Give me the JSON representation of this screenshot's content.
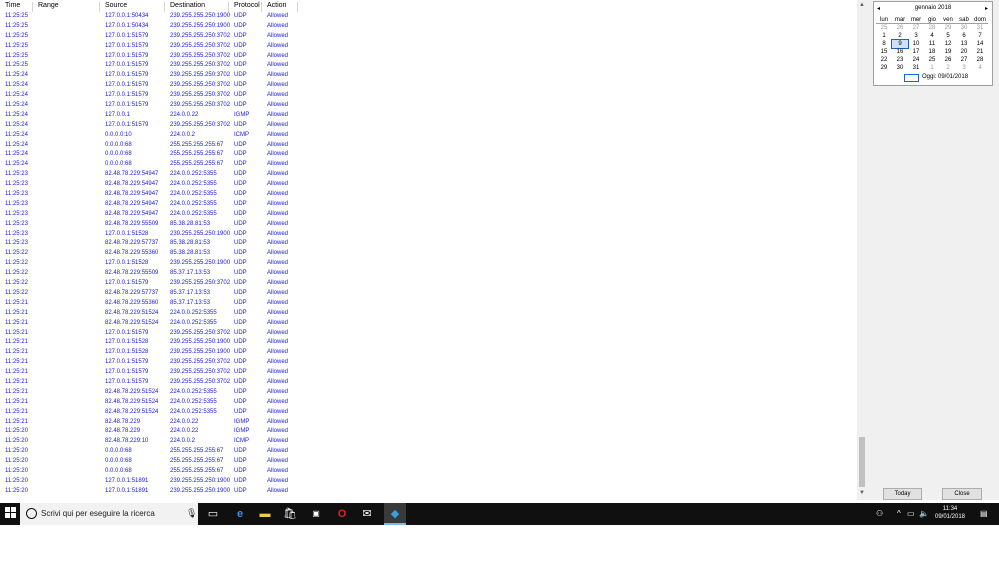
{
  "log": {
    "headers": {
      "time": "Time",
      "range": "Range",
      "source": "Source",
      "destination": "Destination",
      "protocol": "Protocol",
      "action": "Action"
    },
    "rows": [
      [
        "11:25:25",
        "127.0.0.1:50434",
        "239.255.255.250:1900",
        "UDP",
        "Allowed"
      ],
      [
        "11:25:25",
        "127.0.0.1:50434",
        "239.255.255.250:1900",
        "UDP",
        "Allowed"
      ],
      [
        "11:25:25",
        "127.0.0.1:51579",
        "239.255.255.250:3702",
        "UDP",
        "Allowed"
      ],
      [
        "11:25:25",
        "127.0.0.1:51579",
        "239.255.255.250:3702",
        "UDP",
        "Allowed"
      ],
      [
        "11:25:25",
        "127.0.0.1:51579",
        "239.255.255.250:3702",
        "UDP",
        "Allowed"
      ],
      [
        "11:25:25",
        "127.0.0.1:51579",
        "239.255.255.250:3702",
        "UDP",
        "Allowed"
      ],
      [
        "11:25:24",
        "127.0.0.1:51579",
        "239.255.255.250:3702",
        "UDP",
        "Allowed"
      ],
      [
        "11:25:24",
        "127.0.0.1:51579",
        "239.255.255.250:3702",
        "UDP",
        "Allowed"
      ],
      [
        "11:25:24",
        "127.0.0.1:51579",
        "239.255.255.250:3702",
        "UDP",
        "Allowed"
      ],
      [
        "11:25:24",
        "127.0.0.1:51579",
        "239.255.255.250:3702",
        "UDP",
        "Allowed"
      ],
      [
        "11:25:24",
        "127.0.0.1",
        "224.0.0.22",
        "IGMP",
        "Allowed"
      ],
      [
        "11:25:24",
        "127.0.0.1:51579",
        "239.255.255.250:3702",
        "UDP",
        "Allowed"
      ],
      [
        "11:25:24",
        "0.0.0.0:10",
        "224.0.0.2",
        "ICMP",
        "Allowed"
      ],
      [
        "11:25:24",
        "0.0.0.0:68",
        "255.255.255.255:67",
        "UDP",
        "Allowed"
      ],
      [
        "11:25:24",
        "0.0.0.0:68",
        "255.255.255.255:67",
        "UDP",
        "Allowed"
      ],
      [
        "11:25:24",
        "0.0.0.0:68",
        "255.255.255.255:67",
        "UDP",
        "Allowed"
      ],
      [
        "11:25:23",
        "82.48.78.229:54947",
        "224.0.0.252:5355",
        "UDP",
        "Allowed"
      ],
      [
        "11:25:23",
        "82.48.78.229:54947",
        "224.0.0.252:5355",
        "UDP",
        "Allowed"
      ],
      [
        "11:25:23",
        "82.48.78.229:54947",
        "224.0.0.252:5355",
        "UDP",
        "Allowed"
      ],
      [
        "11:25:23",
        "82.48.78.229:54947",
        "224.0.0.252:5355",
        "UDP",
        "Allowed"
      ],
      [
        "11:25:23",
        "82.48.78.229:54947",
        "224.0.0.252:5355",
        "UDP",
        "Allowed"
      ],
      [
        "11:25:23",
        "82.48.78.229:55509",
        "85.38.28.81:53",
        "UDP",
        "Allowed"
      ],
      [
        "11:25:23",
        "127.0.0.1:51528",
        "239.255.255.250:1900",
        "UDP",
        "Allowed"
      ],
      [
        "11:25:23",
        "82.48.78.229:57737",
        "85.38.28.81:53",
        "UDP",
        "Allowed"
      ],
      [
        "11:25:22",
        "82.48.78.229:55360",
        "85.38.28.81:53",
        "UDP",
        "Allowed"
      ],
      [
        "11:25:22",
        "127.0.0.1:51528",
        "239.255.255.250:1900",
        "UDP",
        "Allowed"
      ],
      [
        "11:25:22",
        "82.48.78.229:55509",
        "85.37.17.13:53",
        "UDP",
        "Allowed"
      ],
      [
        "11:25:22",
        "127.0.0.1:51579",
        "239.255.255.250:3702",
        "UDP",
        "Allowed"
      ],
      [
        "11:25:22",
        "82.48.78.229:57737",
        "85.37.17.13:53",
        "UDP",
        "Allowed"
      ],
      [
        "11:25:21",
        "82.48.78.229:55360",
        "85.37.17.13:53",
        "UDP",
        "Allowed"
      ],
      [
        "11:25:21",
        "82.48.78.229:51524",
        "224.0.0.252:5355",
        "UDP",
        "Allowed"
      ],
      [
        "11:25:21",
        "82.48.78.229:51524",
        "224.0.0.252:5355",
        "UDP",
        "Allowed"
      ],
      [
        "11:25:21",
        "127.0.0.1:51579",
        "239.255.255.250:3702",
        "UDP",
        "Allowed"
      ],
      [
        "11:25:21",
        "127.0.0.1:51528",
        "239.255.255.250:1900",
        "UDP",
        "Allowed"
      ],
      [
        "11:25:21",
        "127.0.0.1:51528",
        "239.255.255.250:1900",
        "UDP",
        "Allowed"
      ],
      [
        "11:25:21",
        "127.0.0.1:51579",
        "239.255.255.250:3702",
        "UDP",
        "Allowed"
      ],
      [
        "11:25:21",
        "127.0.0.1:51579",
        "239.255.255.250:3702",
        "UDP",
        "Allowed"
      ],
      [
        "11:25:21",
        "127.0.0.1:51579",
        "239.255.255.250:3702",
        "UDP",
        "Allowed"
      ],
      [
        "11:25:21",
        "82.48.78.229:51524",
        "224.0.0.252:5355",
        "UDP",
        "Allowed"
      ],
      [
        "11:25:21",
        "82.48.78.229:51524",
        "224.0.0.252:5355",
        "UDP",
        "Allowed"
      ],
      [
        "11:25:21",
        "82.48.78.229:51524",
        "224.0.0.252:5355",
        "UDP",
        "Allowed"
      ],
      [
        "11:25:21",
        "82.48.78.229",
        "224.0.0.22",
        "IGMP",
        "Allowed"
      ],
      [
        "11:25:20",
        "82.48.78.229",
        "224.0.0.22",
        "IGMP",
        "Allowed"
      ],
      [
        "11:25:20",
        "82.48.78.229:10",
        "224.0.0.2",
        "ICMP",
        "Allowed"
      ],
      [
        "11:25:20",
        "0.0.0.0:68",
        "255.255.255.255:67",
        "UDP",
        "Allowed"
      ],
      [
        "11:25:20",
        "0.0.0.0:68",
        "255.255.255.255:67",
        "UDP",
        "Allowed"
      ],
      [
        "11:25:20",
        "0.0.0.0:68",
        "255.255.255.255:67",
        "UDP",
        "Allowed"
      ],
      [
        "11:25:20",
        "127.0.0.1:51891",
        "239.255.255.250:1900",
        "UDP",
        "Allowed"
      ],
      [
        "11:25:20",
        "127.0.0.1:51891",
        "239.255.255.250:1900",
        "UDP",
        "Allowed"
      ]
    ]
  },
  "calendar": {
    "month_title": "gennaio 2018",
    "prev": "◂",
    "next": "▸",
    "weekdays": [
      "lun",
      "mar",
      "mer",
      "gio",
      "ven",
      "sab",
      "dom"
    ],
    "weeks": [
      [
        "25",
        "26",
        "27",
        "28",
        "29",
        "30",
        "31"
      ],
      [
        "1",
        "2",
        "3",
        "4",
        "5",
        "6",
        "7"
      ],
      [
        "8",
        "9",
        "10",
        "11",
        "12",
        "13",
        "14"
      ],
      [
        "15",
        "16",
        "17",
        "18",
        "19",
        "20",
        "21"
      ],
      [
        "22",
        "23",
        "24",
        "25",
        "26",
        "27",
        "28"
      ],
      [
        "29",
        "30",
        "31",
        "1",
        "2",
        "3",
        "4"
      ]
    ],
    "today_label": "Oggi: 09/01/2018"
  },
  "buttons": {
    "today": "Today",
    "close": "Close"
  },
  "taskbar": {
    "search_placeholder": "Scrivi qui per eseguire la ricerca",
    "time": "11:34",
    "date": "09/01/2018"
  }
}
